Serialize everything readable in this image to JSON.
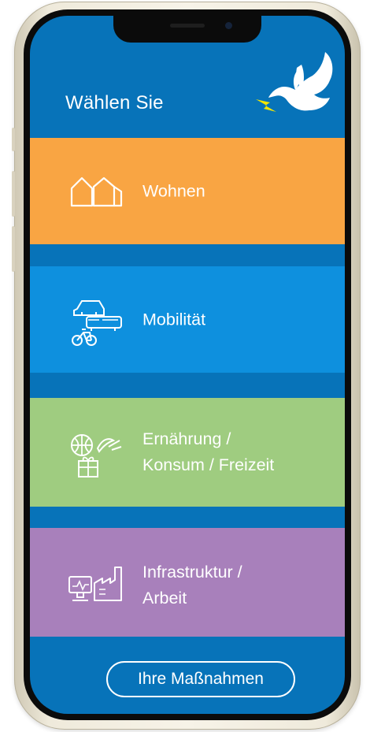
{
  "header": {
    "title": "Wählen Sie",
    "logo_icon": "dove-icon"
  },
  "tiles": [
    {
      "id": "wohnen",
      "label": "Wohnen",
      "icon": "houses-icon",
      "color": "#f9a543"
    },
    {
      "id": "mobilitaet",
      "label": "Mobilität",
      "icon": "vehicles-icon",
      "color": "#0e90de"
    },
    {
      "id": "ernaehrung",
      "label": "Ernährung /\nKonsum / Freizeit",
      "icon": "food-leisure-icon",
      "color": "#9fcc80"
    },
    {
      "id": "infrastruktur",
      "label": "Infrastruktur /\nArbeit",
      "icon": "computer-factory-icon",
      "color": "#a880bb"
    }
  ],
  "footer": {
    "button_label": "Ihre Maßnahmen"
  },
  "colors": {
    "background": "#0773b9",
    "logo_accent": "#f3e600"
  }
}
